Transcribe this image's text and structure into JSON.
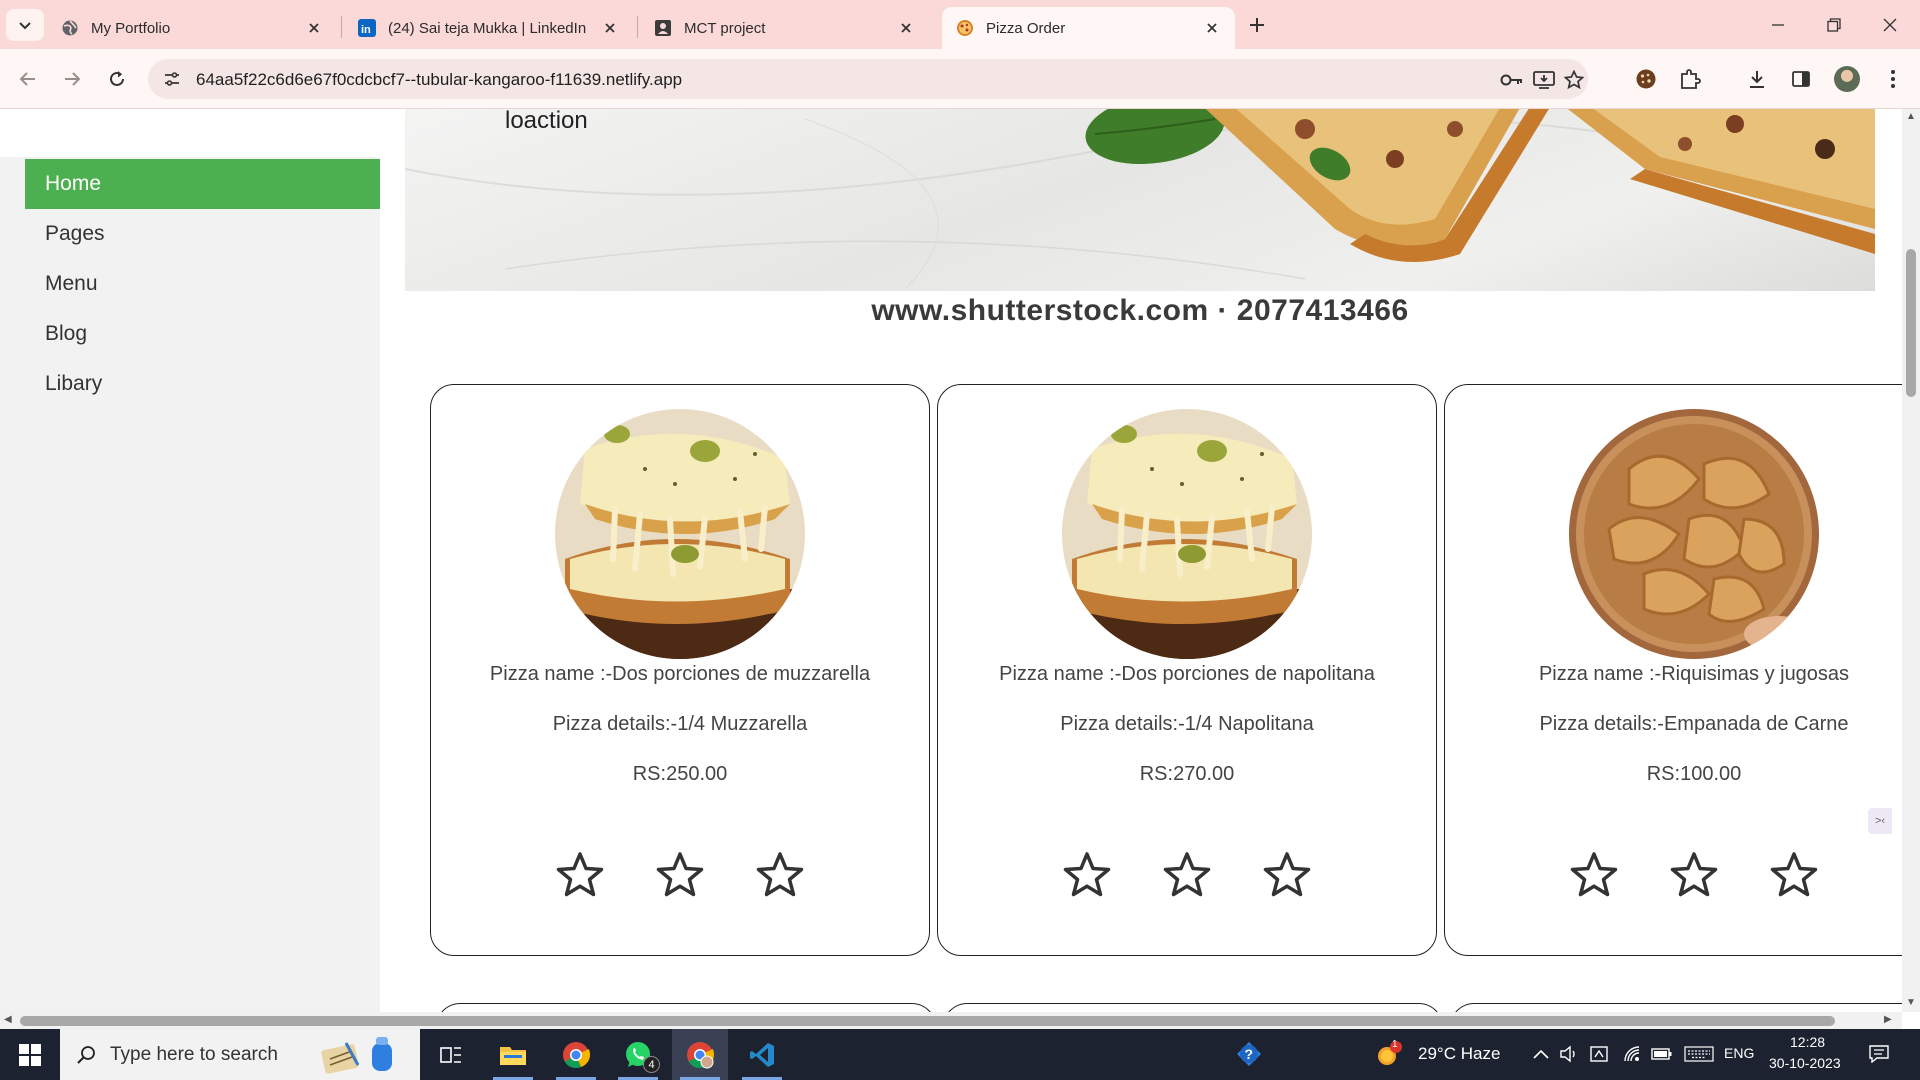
{
  "browser": {
    "tabs": [
      {
        "title": "My Portfolio",
        "icon": "globe-icon",
        "active": false
      },
      {
        "title": "(24) Sai teja Mukka | LinkedIn",
        "icon": "linkedin-icon",
        "active": false
      },
      {
        "title": "MCT project",
        "icon": "contact-card-icon",
        "active": false
      },
      {
        "title": "Pizza Order",
        "icon": "pizza-icon",
        "active": true
      }
    ],
    "url": "64aa5f22c6d6e67f0cdcbcf7--tubular-kangaroo-f11639.netlify.app"
  },
  "sidebar": {
    "items": [
      {
        "label": "Home",
        "active": true
      },
      {
        "label": "Pages",
        "active": false
      },
      {
        "label": "Menu",
        "active": false
      },
      {
        "label": "Blog",
        "active": false
      },
      {
        "label": "Libary",
        "active": false
      }
    ]
  },
  "hero": {
    "location_text": "loaction",
    "watermark": "www.shutterstock.com · 2077413466"
  },
  "cards": [
    {
      "name": "Pizza name :-Dos porciones de muzzarella",
      "details": "Pizza details:-1/4 Muzzarella",
      "price": "RS:250.00",
      "photo": "cheese-pizza-slice",
      "rating": 0,
      "max_rating": 3
    },
    {
      "name": "Pizza name :-Dos porciones de napolitana",
      "details": "Pizza details:-1/4 Napolitana",
      "price": "RS:270.00",
      "photo": "cheese-pizza-slice",
      "rating": 0,
      "max_rating": 3
    },
    {
      "name": "Pizza name :-Riquisimas y jugosas",
      "details": "Pizza details:-Empanada de Carne",
      "price": "RS:100.00",
      "photo": "empanadas",
      "rating": 0,
      "max_rating": 3
    }
  ],
  "taskbar": {
    "search_placeholder": "Type here to search",
    "whatsapp_badge": "4",
    "weather": "29°C  Haze",
    "weather_alert": "1",
    "language": "ENG",
    "time": "12:28",
    "date": "30-10-2023"
  },
  "colors": {
    "tabbar_bg": "#fbd9d8",
    "sidebar_active": "#4caf50",
    "sidebar_bg": "#f2f2f2",
    "taskbar_bg": "#1c2230"
  }
}
